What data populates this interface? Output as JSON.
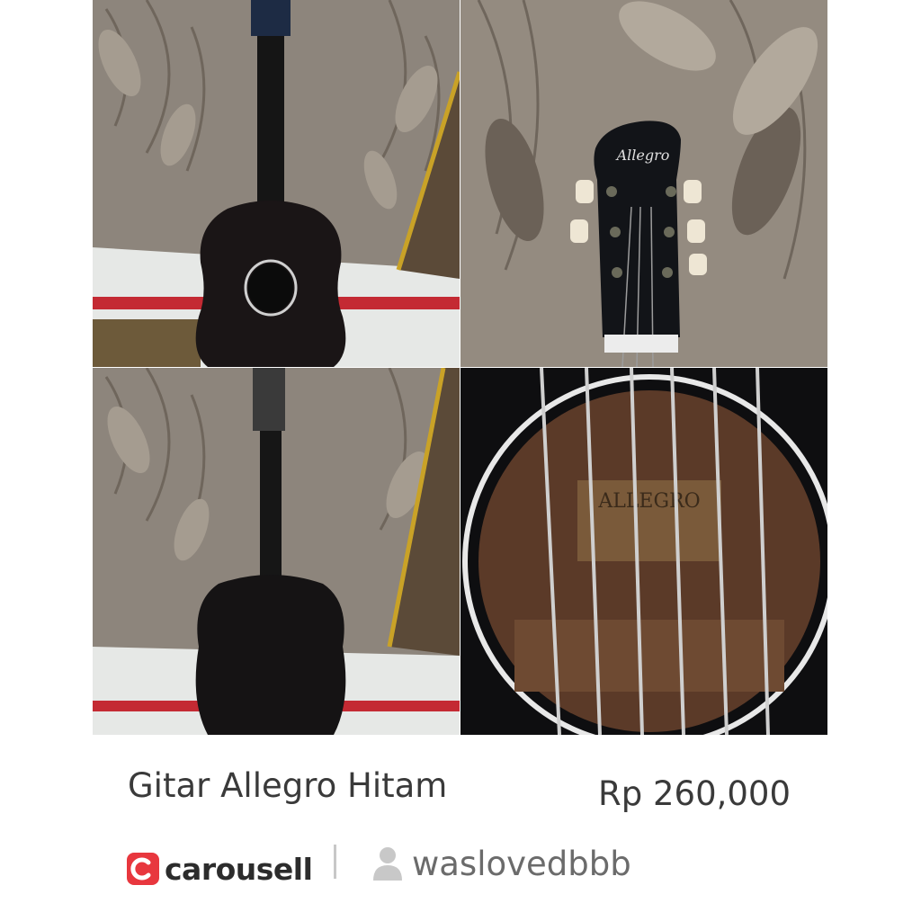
{
  "listing": {
    "title": "Gitar Allegro Hitam",
    "price": "Rp 260,000",
    "photos": [
      {
        "name": "guitar-front-photo"
      },
      {
        "name": "guitar-headstock-photo",
        "headstock_logo": "Allegro"
      },
      {
        "name": "guitar-back-photo"
      },
      {
        "name": "guitar-soundhole-photo",
        "label_text": "ALLEGRO"
      }
    ]
  },
  "brand": {
    "name": "carousell",
    "icon": "carousell-logo-icon",
    "color": "#e8373e"
  },
  "seller": {
    "username": "waslovedbbb",
    "icon": "user-icon"
  },
  "colors": {
    "title": "#3a3a3a",
    "price": "#3a3a3a",
    "seller": "#6b6b6b",
    "divider": "#c8c8c8"
  }
}
